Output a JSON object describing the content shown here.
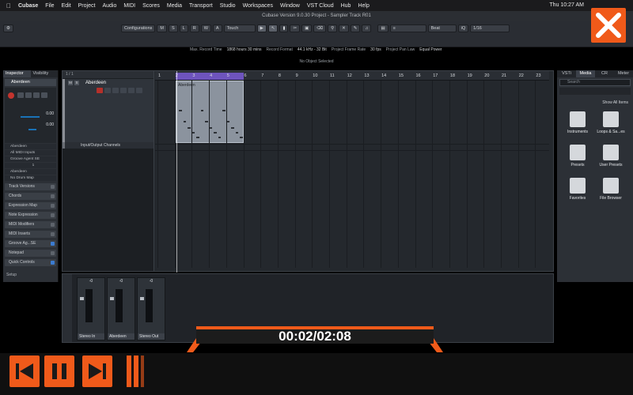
{
  "menubar": {
    "app": "Cubase",
    "items": [
      "File",
      "Edit",
      "Project",
      "Audio",
      "MIDI",
      "Scores",
      "Media",
      "Transport",
      "Studio",
      "Workspaces",
      "Window",
      "VST Cloud",
      "Hub",
      "Help"
    ],
    "clock": "Thu 10:27 AM"
  },
  "titlebar": {
    "title": "Cubase Version 9.0.30 Project - Sampler Track R01"
  },
  "toolbar": {
    "configurations": "Configurations",
    "mode_buttons": [
      "M",
      "S",
      "L",
      "R",
      "W",
      "A"
    ],
    "automation": "Touch",
    "snap": "Beat",
    "quantize": "1/16",
    "info": {
      "max_record_label": "Max. Record Time",
      "max_record_value": "1868 hours 30 mins",
      "record_format_label": "Record Format",
      "record_format_value": "44.1 kHz - 32 Bit",
      "frame_rate_label": "Project Frame Rate",
      "frame_rate_value": "30 fps",
      "pan_law_label": "Project Pan Law",
      "pan_law_value": "Equal Power"
    },
    "status": "No Object Selected"
  },
  "inspector": {
    "tabs": [
      "Inspector",
      "Visibility"
    ],
    "track_name": "Aberdeen",
    "values": [
      "0.00",
      "0.00"
    ],
    "routing": [
      "Aberdeen",
      "All MIDI Inputs",
      "Groove Agent SE"
    ],
    "routing_field": "1",
    "routing2": [
      "Aberdeen",
      "No Drum Map"
    ],
    "sections": [
      "Track Versions",
      "Chords",
      "Expression Map",
      "Note Expression",
      "MIDI Modifiers",
      "MIDI Inserts",
      "Groove Ag...SE",
      "Notepad",
      "Quick Controls"
    ],
    "setup": "Setup"
  },
  "project": {
    "track_count": "1 / 1",
    "tracks": [
      {
        "name": "Aberdeen"
      },
      {
        "name": "Input/Output Channels"
      }
    ],
    "event_name": "Aberdeen",
    "ruler": [
      "1",
      "2",
      "3",
      "4",
      "5",
      "6",
      "7",
      "8",
      "9",
      "10",
      "11",
      "12",
      "13",
      "14",
      "15",
      "16",
      "17",
      "18",
      "19",
      "20",
      "21",
      "22",
      "23"
    ]
  },
  "rightzone": {
    "tabs": [
      "VSTi",
      "Media",
      "CR",
      "Meter"
    ],
    "search_placeholder": "Search",
    "show_all": "Show All Items",
    "items": [
      "Instruments",
      "Loops & Sa...es",
      "Presets",
      "User Presets",
      "Favorites",
      "File Browser"
    ]
  },
  "mixer": {
    "strips": [
      {
        "name": "Stereo In",
        "value": "-0"
      },
      {
        "name": "Aberdeen",
        "value": "-0"
      },
      {
        "name": "Stereo Out",
        "value": "-0"
      }
    ]
  },
  "video": {
    "timecode": "00:02/02:08"
  }
}
